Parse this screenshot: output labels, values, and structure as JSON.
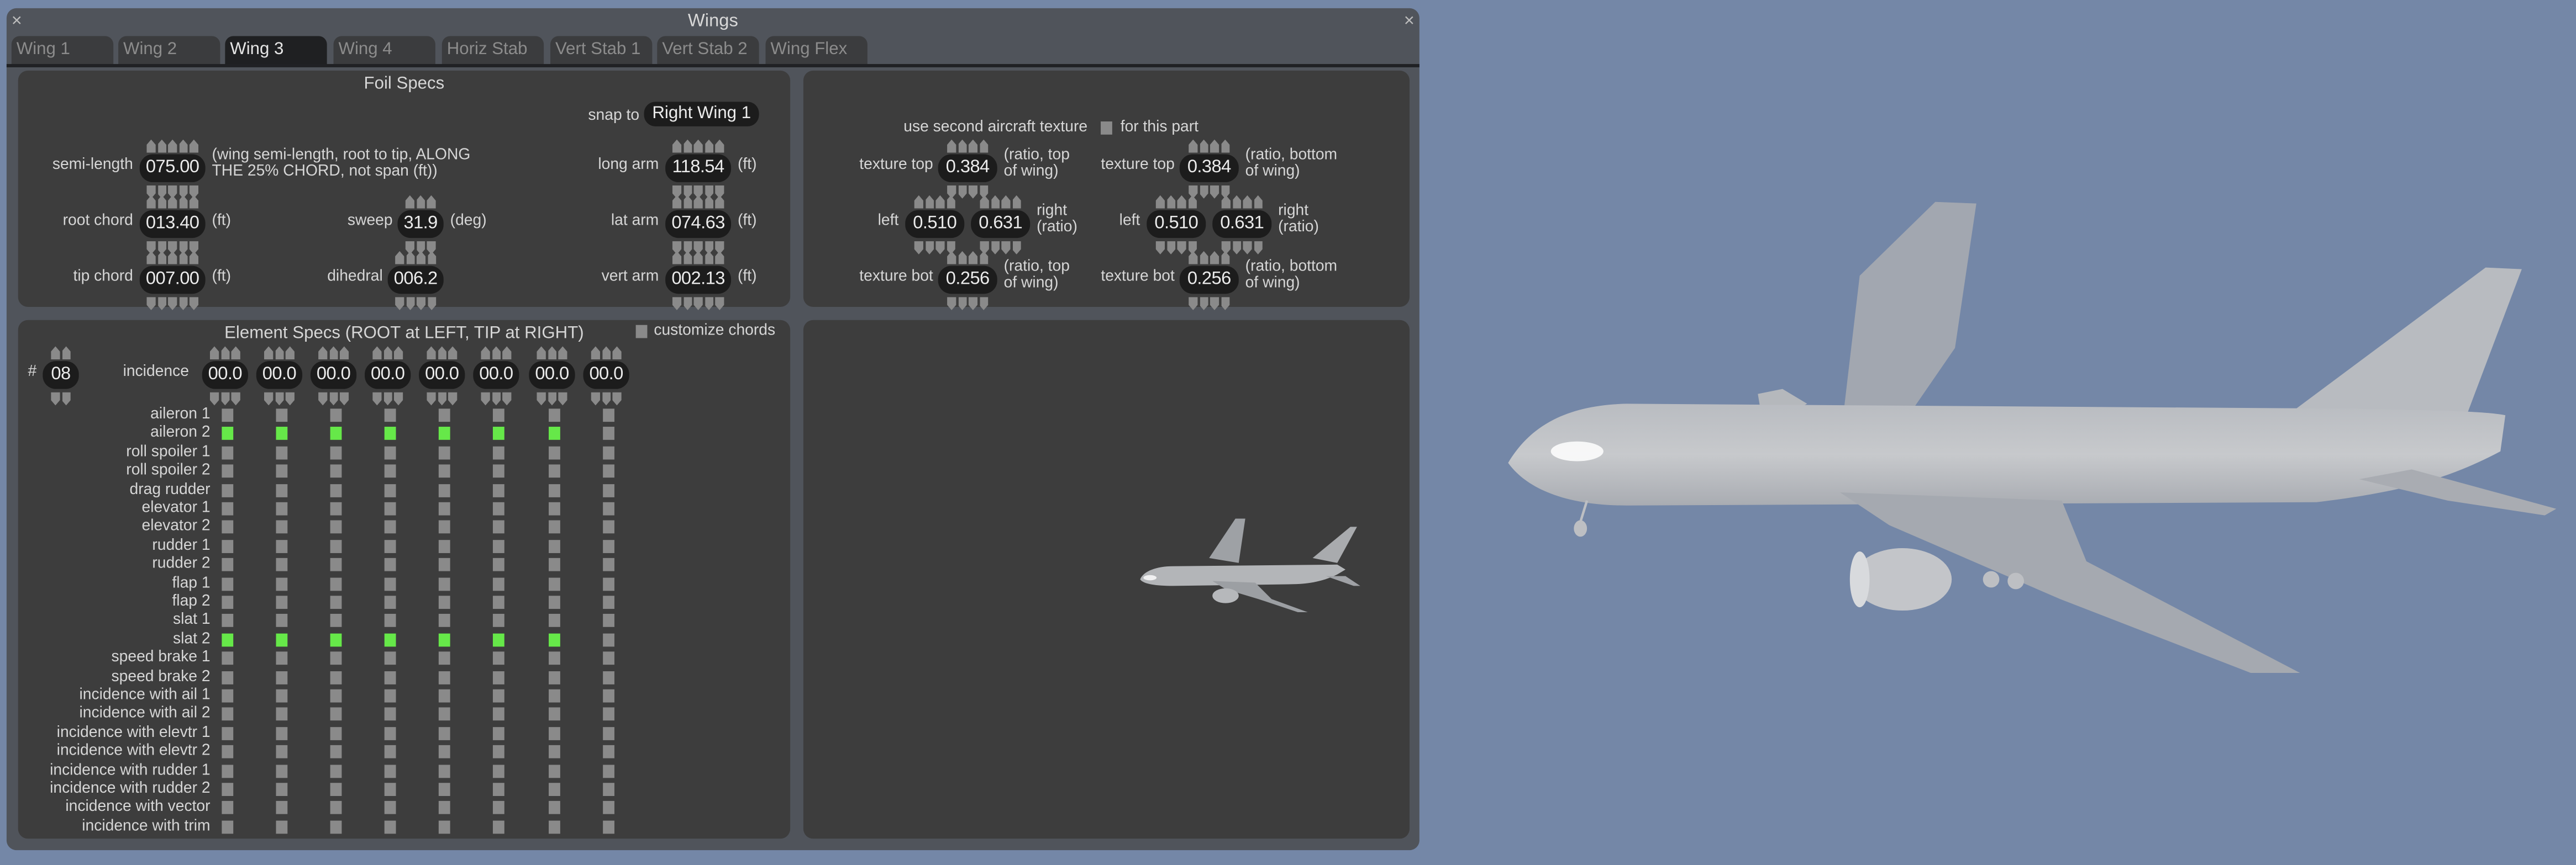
{
  "window": {
    "title": "Wings",
    "close_left": "×",
    "close_right": "×",
    "tabs": [
      {
        "label": "Wing 1",
        "active": false
      },
      {
        "label": "Wing 2",
        "active": false
      },
      {
        "label": "Wing 3",
        "active": true
      },
      {
        "label": "Wing 4",
        "active": false
      },
      {
        "label": "Horiz Stab",
        "active": false
      },
      {
        "label": "Vert Stab 1",
        "active": false
      },
      {
        "label": "Vert Stab 2",
        "active": false
      },
      {
        "label": "Wing Flex",
        "active": false
      }
    ]
  },
  "foil_specs": {
    "title": "Foil Specs",
    "snap_to_label": "snap to",
    "snap_to_value": "Right Wing 1",
    "semi_length": {
      "label": "semi-length",
      "value": "075.00",
      "note_line1": "(wing semi-length, root to tip, ALONG",
      "note_line2": "THE 25% CHORD, not span (ft))"
    },
    "root_chord": {
      "label": "root chord",
      "value": "013.40",
      "unit": "(ft)"
    },
    "tip_chord": {
      "label": "tip chord",
      "value": "007.00",
      "unit": "(ft)"
    },
    "sweep": {
      "label": "sweep",
      "value": "31.9",
      "unit": "(deg)"
    },
    "dihedral": {
      "label": "dihedral",
      "value": "006.2"
    },
    "long_arm": {
      "label": "long arm",
      "value": "118.54",
      "unit": "(ft)"
    },
    "lat_arm": {
      "label": "lat arm",
      "value": "074.63",
      "unit": "(ft)"
    },
    "vert_arm": {
      "label": "vert arm",
      "value": "002.13",
      "unit": "(ft)"
    }
  },
  "texture": {
    "use_second_label": "use second aircraft texture",
    "use_second_suffix": "for this part",
    "use_second_checked": false,
    "top": {
      "tex_top": {
        "label": "texture top",
        "value": "0.384",
        "note_line1": "(ratio, top",
        "note_line2": "of wing)"
      },
      "left": {
        "label": "left",
        "value": "0.510"
      },
      "right": {
        "value": "0.631",
        "note_line1": "right",
        "note_line2": "(ratio)"
      },
      "tex_bot": {
        "label": "texture bot",
        "value": "0.256",
        "note_line1": "(ratio, top",
        "note_line2": "of wing)"
      }
    },
    "bottom": {
      "tex_top": {
        "label": "texture top",
        "value": "0.384",
        "note_line1": "(ratio, bottom",
        "note_line2": "of wing)"
      },
      "left": {
        "label": "left",
        "value": "0.510"
      },
      "right": {
        "value": "0.631",
        "note_line1": "right",
        "note_line2": "(ratio)"
      },
      "tex_bot": {
        "label": "texture bot",
        "value": "0.256",
        "note_line1": "(ratio, bottom",
        "note_line2": "of wing)"
      }
    }
  },
  "element_specs": {
    "title": "Element Specs (ROOT at LEFT, TIP at RIGHT)",
    "customize_chords_label": "customize chords",
    "customize_chords_checked": false,
    "count_label": "#",
    "count_value": "08",
    "incidence_label": "incidence",
    "incidence_values": [
      "00.0",
      "00.0",
      "00.0",
      "00.0",
      "00.0",
      "00.0",
      "00.0",
      "00.0"
    ],
    "rows": [
      {
        "label": "aileron 1",
        "checks": [
          false,
          false,
          false,
          false,
          false,
          false,
          false,
          false
        ]
      },
      {
        "label": "aileron 2",
        "checks": [
          true,
          true,
          true,
          true,
          true,
          true,
          true,
          false
        ]
      },
      {
        "label": "roll spoiler 1",
        "checks": [
          false,
          false,
          false,
          false,
          false,
          false,
          false,
          false
        ]
      },
      {
        "label": "roll spoiler 2",
        "checks": [
          false,
          false,
          false,
          false,
          false,
          false,
          false,
          false
        ]
      },
      {
        "label": "drag rudder",
        "checks": [
          false,
          false,
          false,
          false,
          false,
          false,
          false,
          false
        ]
      },
      {
        "label": "elevator 1",
        "checks": [
          false,
          false,
          false,
          false,
          false,
          false,
          false,
          false
        ]
      },
      {
        "label": "elevator 2",
        "checks": [
          false,
          false,
          false,
          false,
          false,
          false,
          false,
          false
        ]
      },
      {
        "label": "rudder 1",
        "checks": [
          false,
          false,
          false,
          false,
          false,
          false,
          false,
          false
        ]
      },
      {
        "label": "rudder 2",
        "checks": [
          false,
          false,
          false,
          false,
          false,
          false,
          false,
          false
        ]
      },
      {
        "label": "flap 1",
        "checks": [
          false,
          false,
          false,
          false,
          false,
          false,
          false,
          false
        ]
      },
      {
        "label": "flap 2",
        "checks": [
          false,
          false,
          false,
          false,
          false,
          false,
          false,
          false
        ]
      },
      {
        "label": "slat 1",
        "checks": [
          false,
          false,
          false,
          false,
          false,
          false,
          false,
          false
        ]
      },
      {
        "label": "slat 2",
        "checks": [
          true,
          true,
          true,
          true,
          true,
          true,
          true,
          false
        ]
      },
      {
        "label": "speed brake 1",
        "checks": [
          false,
          false,
          false,
          false,
          false,
          false,
          false,
          false
        ]
      },
      {
        "label": "speed brake 2",
        "checks": [
          false,
          false,
          false,
          false,
          false,
          false,
          false,
          false
        ]
      },
      {
        "label": "incidence with ail 1",
        "checks": [
          false,
          false,
          false,
          false,
          false,
          false,
          false,
          false
        ]
      },
      {
        "label": "incidence with ail 2",
        "checks": [
          false,
          false,
          false,
          false,
          false,
          false,
          false,
          false
        ]
      },
      {
        "label": "incidence with elevtr 1",
        "checks": [
          false,
          false,
          false,
          false,
          false,
          false,
          false,
          false
        ]
      },
      {
        "label": "incidence with elevtr 2",
        "checks": [
          false,
          false,
          false,
          false,
          false,
          false,
          false,
          false
        ]
      },
      {
        "label": "incidence with rudder 1",
        "checks": [
          false,
          false,
          false,
          false,
          false,
          false,
          false,
          false
        ]
      },
      {
        "label": "incidence with rudder 2",
        "checks": [
          false,
          false,
          false,
          false,
          false,
          false,
          false,
          false
        ]
      },
      {
        "label": "incidence with vector",
        "checks": [
          false,
          false,
          false,
          false,
          false,
          false,
          false,
          false
        ]
      },
      {
        "label": "incidence with trim",
        "checks": [
          false,
          false,
          false,
          false,
          false,
          false,
          false,
          false
        ]
      }
    ]
  },
  "colors": {
    "sky": "#7487a7",
    "window": "#50545b",
    "panel": "#3d3d3d",
    "field": "#1c1c1c",
    "check_off": "#8a8a8a",
    "check_on": "#66e849",
    "aircraft": "#c4c6ca"
  }
}
